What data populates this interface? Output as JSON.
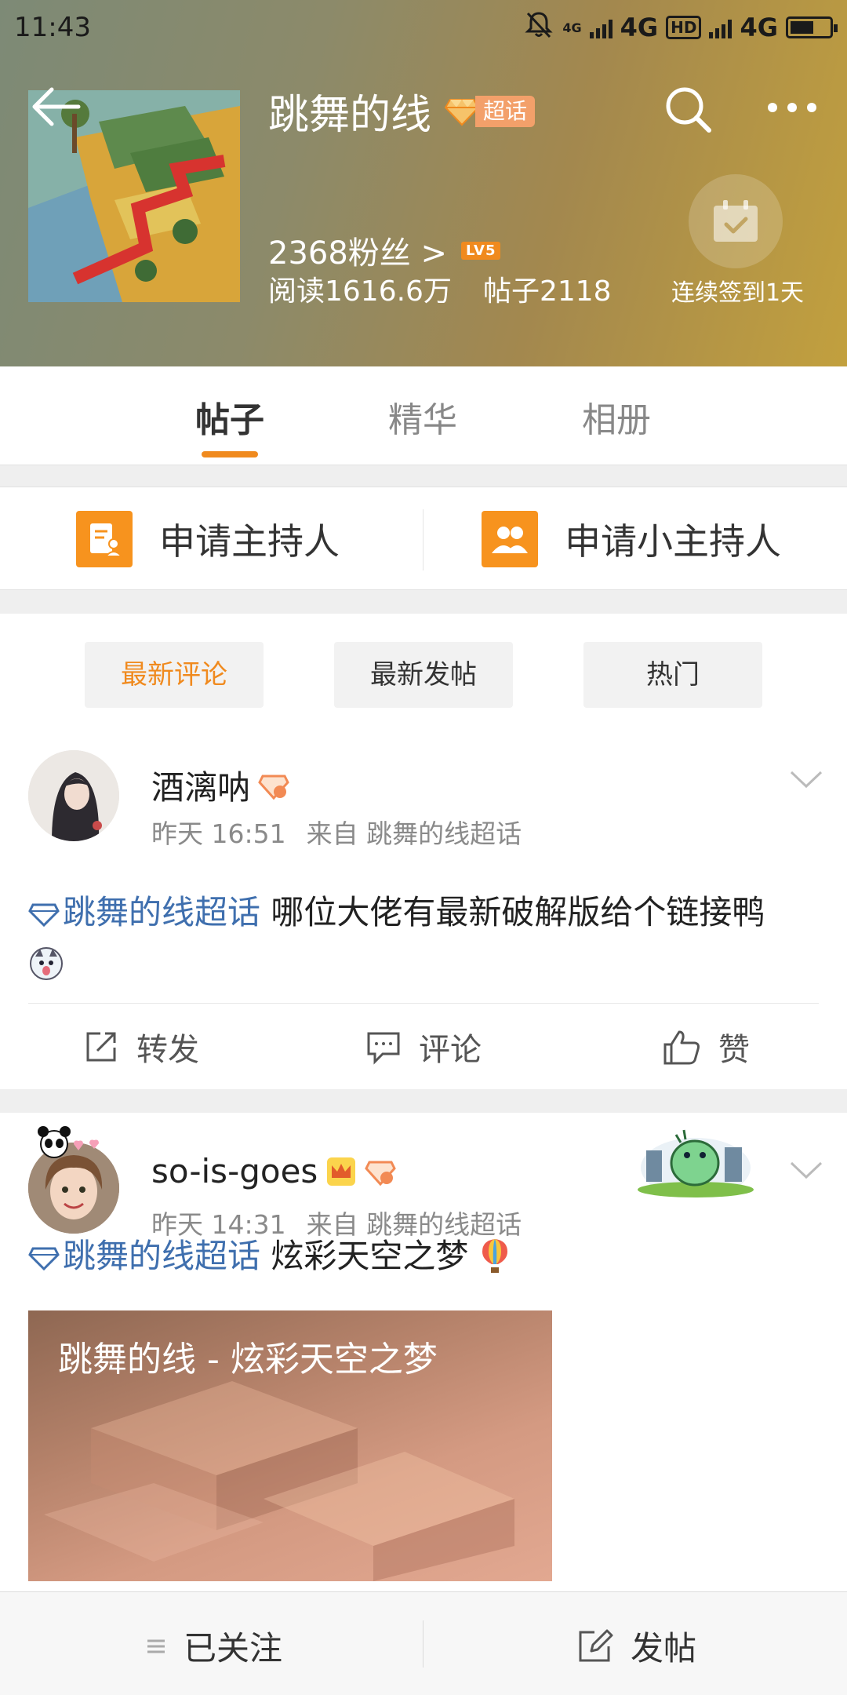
{
  "status_bar": {
    "time": "11:43",
    "network_1": "4G",
    "network_2": "4G",
    "hd": "HD",
    "small_4g": "4G",
    "battery_level": 0.6
  },
  "topic": {
    "title": "跳舞的线",
    "badge_label": "超话",
    "fans": "2368粉丝 >",
    "level": "LV5",
    "reads": "阅读1616.6万",
    "posts": "帖子2118",
    "checkin_label": "连续签到1天"
  },
  "tabs": [
    {
      "label": "帖子",
      "active": true
    },
    {
      "label": "精华",
      "active": false
    },
    {
      "label": "相册",
      "active": false
    }
  ],
  "host_apply": {
    "host_label": "申请主持人",
    "mini_host_label": "申请小主持人"
  },
  "sort": [
    {
      "label": "最新评论",
      "active": true
    },
    {
      "label": "最新发帖",
      "active": false
    },
    {
      "label": "热门",
      "active": false
    }
  ],
  "posts": [
    {
      "username": "酒漓呐",
      "time": "昨天 16:51",
      "source": "来自 跳舞的线超话",
      "topic_tag": "跳舞的线超话",
      "text": " 哪位大佬有最新破解版给个链接鸭",
      "actions": {
        "repost": "转发",
        "comment": "评论",
        "like": "赞"
      }
    },
    {
      "username": "so-is-goes",
      "time": "昨天 14:31",
      "source": "来自 跳舞的线超话",
      "topic_tag": "跳舞的线超话",
      "text": " 炫彩天空之梦",
      "video_title": "跳舞的线 - 炫彩天空之梦"
    }
  ],
  "bottom_bar": {
    "follow_label": "已关注",
    "post_label": "发帖"
  },
  "colors": {
    "accent": "#f08a1e",
    "link": "#3f6fae",
    "host_icon": "#f7931e"
  }
}
